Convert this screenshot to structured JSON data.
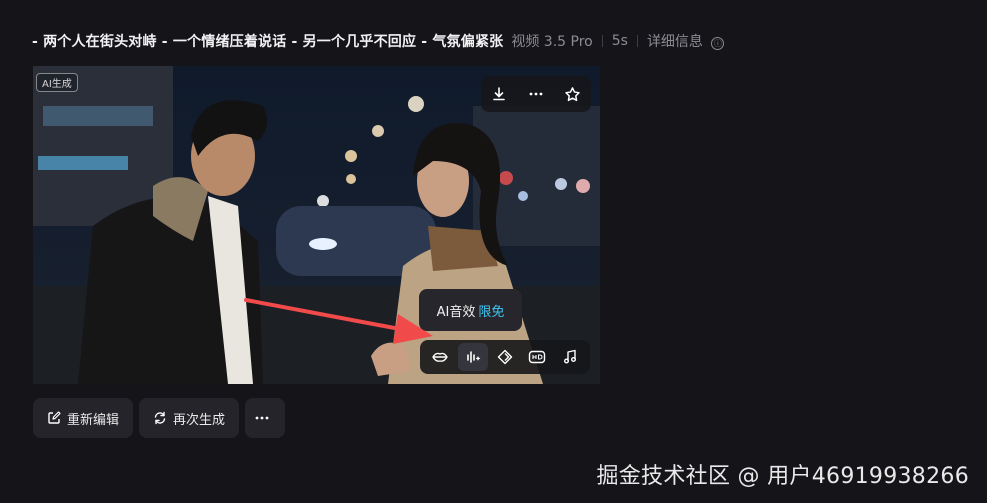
{
  "header": {
    "prompt": "- 两个人在街头对峙 - 一个情绪压着说话 - 另一个几乎不回应 - 气氛偏紧张",
    "model": "视频 3.5 Pro",
    "duration": "5s",
    "details_label": "详细信息",
    "info_icon": "ⓘ"
  },
  "video": {
    "ai_badge": "AI生成",
    "top_toolbar": [
      "download-icon",
      "more-icon",
      "star-icon"
    ],
    "tooltip": {
      "label": "AI音效",
      "tag": "限免",
      "tag_color": "#3fc7f5"
    },
    "tools": [
      "lip-sync-icon",
      "ai-sound-icon",
      "frame-icon",
      "hd-icon",
      "music-icon"
    ],
    "active_tool": "ai-sound-icon"
  },
  "actions": {
    "reedit": "重新编辑",
    "regenerate": "再次生成",
    "more_icon": "more-icon"
  },
  "watermark": "掘金技术社区 @ 用户46919938266",
  "colors": {
    "background": "#151519",
    "accent": "#3fc7f5",
    "arrow": "#f04a4a"
  }
}
